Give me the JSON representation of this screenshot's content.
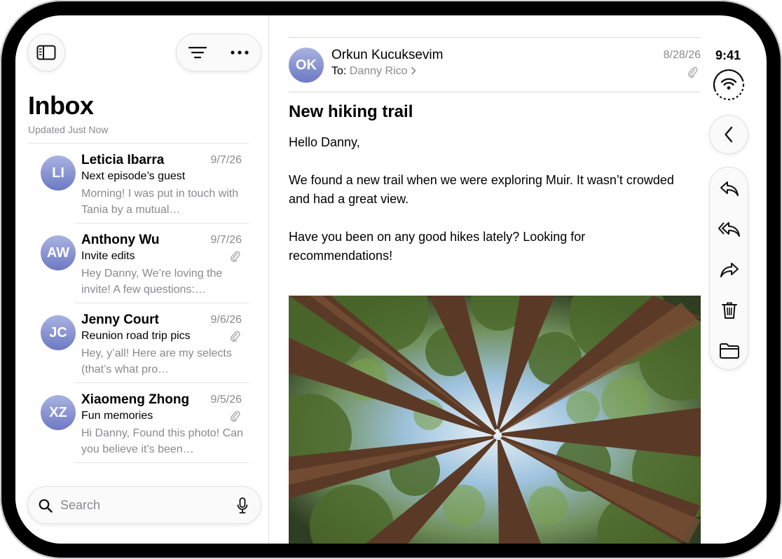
{
  "status": {
    "time": "9:41"
  },
  "sidebar": {
    "title": "Inbox",
    "updated": "Updated Just Now",
    "messages": [
      {
        "initials": "LI",
        "sender": "Leticia Ibarra",
        "date": "9/7/26",
        "subject": "Next episode’s guest",
        "preview": "Morning! I was put in touch with Tania by a mutual…",
        "attachment": false
      },
      {
        "initials": "AW",
        "sender": "Anthony Wu",
        "date": "9/7/26",
        "subject": "Invite edits",
        "preview": "Hey Danny, We’re loving the invite! A few questions:…",
        "attachment": true
      },
      {
        "initials": "JC",
        "sender": "Jenny Court",
        "date": "9/6/26",
        "subject": "Reunion road trip pics",
        "preview": "Hey, y’all! Here are my selects (that’s what pro…",
        "attachment": true
      },
      {
        "initials": "XZ",
        "sender": "Xiaomeng Zhong",
        "date": "9/5/26",
        "subject": "Fun memories",
        "preview": "Hi Danny, Found this photo! Can you believe it’s been…",
        "attachment": true
      }
    ],
    "search": {
      "placeholder": "Search"
    }
  },
  "email": {
    "initials": "OK",
    "from": "Orkun Kucuksevim",
    "to_label": "To:",
    "to": "Danny Rico",
    "date": "8/28/26",
    "subject": "New hiking trail",
    "body": [
      "Hello Danny,",
      "We found a new trail when we were exploring Muir. It wasn’t crowded and had a great view.",
      "Have you been on any good hikes lately? Looking for recommendations!"
    ]
  },
  "colors": {
    "avatar_top": "#a9b3e0",
    "avatar_bottom": "#6d79c4",
    "secondary_text": "#8a8a8e"
  }
}
